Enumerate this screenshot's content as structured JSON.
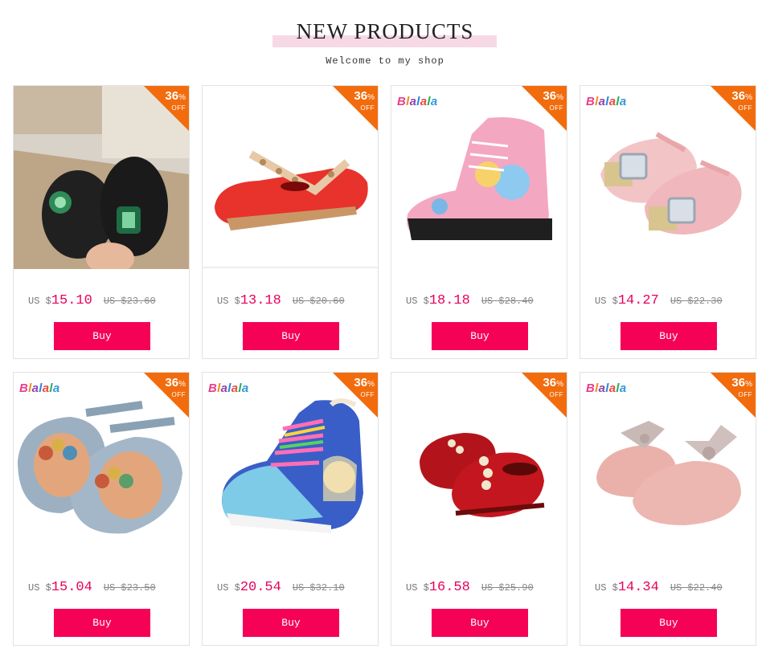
{
  "header": {
    "title": "NEW PRODUCTS",
    "subtitle": "Welcome to my shop"
  },
  "colors": {
    "accent": "#f50257",
    "price": "#e6005c",
    "badge": "#f26c0d",
    "title_bar": "#f7d9e6"
  },
  "products": [
    {
      "brand": "",
      "discount": "36",
      "pct": "%",
      "off": "OFF",
      "currency": "US $",
      "price": "15.10",
      "original": "US $23.60",
      "buy": "Buy",
      "shoe": "black-jeweled-flats"
    },
    {
      "brand": "",
      "discount": "36",
      "pct": "%",
      "off": "OFF",
      "currency": "US $",
      "price": "13.18",
      "original": "US $20.60",
      "buy": "Buy",
      "shoe": "red-studded-flats"
    },
    {
      "brand": "Blalala",
      "discount": "36",
      "pct": "%",
      "off": "OFF",
      "currency": "US $",
      "price": "18.18",
      "original": "US $28.40",
      "buy": "Buy",
      "shoe": "pink-frozen-boots"
    },
    {
      "brand": "Blalala",
      "discount": "36",
      "pct": "%",
      "off": "OFF",
      "currency": "US $",
      "price": "14.27",
      "original": "US $22.30",
      "buy": "Buy",
      "shoe": "pink-glitter-flats"
    },
    {
      "brand": "Blalala",
      "discount": "36",
      "pct": "%",
      "off": "OFF",
      "currency": "US $",
      "price": "15.04",
      "original": "US $23.50",
      "buy": "Buy",
      "shoe": "grey-jeweled-flats"
    },
    {
      "brand": "Blalala",
      "discount": "36",
      "pct": "%",
      "off": "OFF",
      "currency": "US $",
      "price": "20.54",
      "original": "US $32.10",
      "buy": "Buy",
      "shoe": "blue-frozen-sneakers"
    },
    {
      "brand": "",
      "discount": "36",
      "pct": "%",
      "off": "OFF",
      "currency": "US $",
      "price": "16.58",
      "original": "US $25.90",
      "buy": "Buy",
      "shoe": "red-pearl-loafers"
    },
    {
      "brand": "Blalala",
      "discount": "36",
      "pct": "%",
      "off": "OFF",
      "currency": "US $",
      "price": "14.34",
      "original": "US $22.40",
      "buy": "Buy",
      "shoe": "pink-bow-flats"
    }
  ]
}
